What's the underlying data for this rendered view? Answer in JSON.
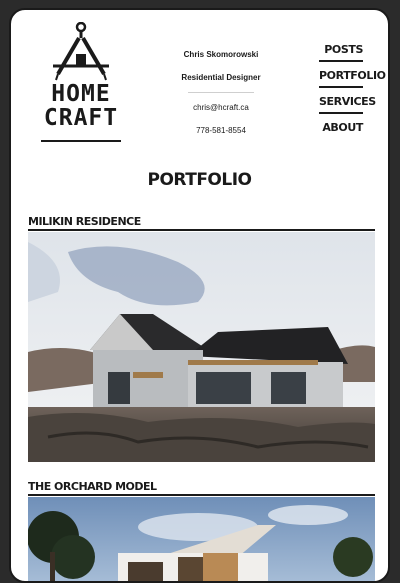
{
  "brand": {
    "line1": "HOME",
    "line2": "CRAFT"
  },
  "contact": {
    "name": "Chris Skomorowski",
    "role": "Residential Designer",
    "email": "chris@hcraft.ca",
    "phone": "778-581-8554"
  },
  "nav": {
    "items": [
      {
        "label": "POSTS"
      },
      {
        "label": "PORTFOLIO"
      },
      {
        "label": "SERVICES"
      },
      {
        "label": "ABOUT"
      }
    ]
  },
  "page": {
    "title": "PORTFOLIO"
  },
  "projects": [
    {
      "title": "MILIKIN RESIDENCE"
    },
    {
      "title": "THE ORCHARD MODEL"
    }
  ]
}
